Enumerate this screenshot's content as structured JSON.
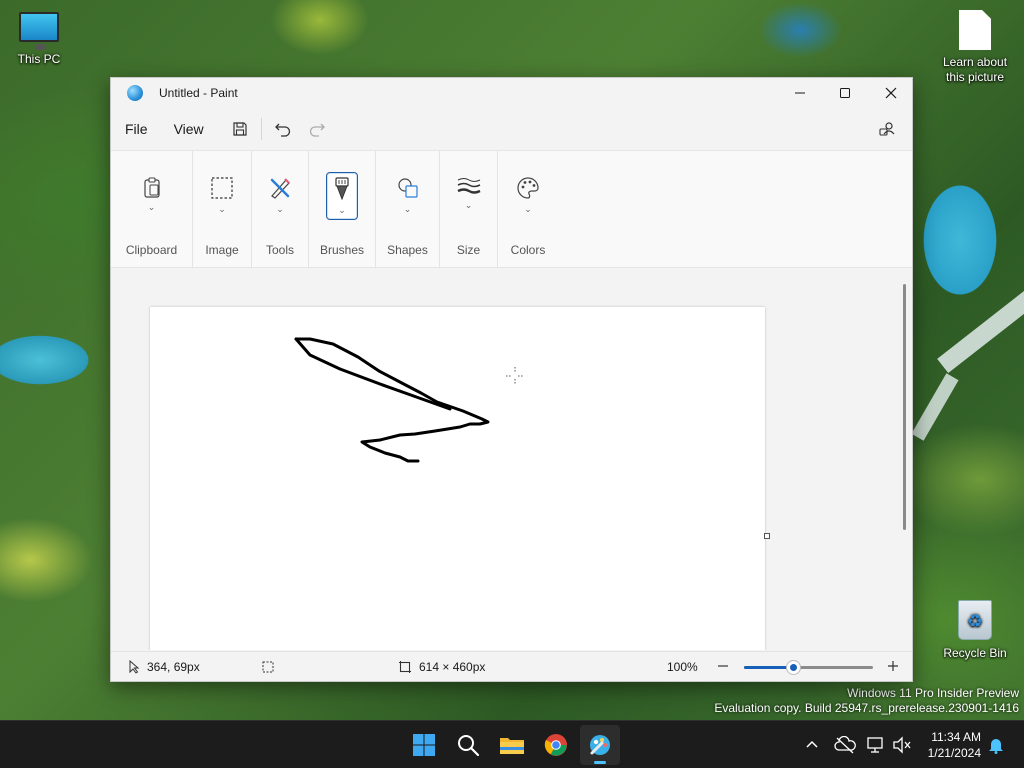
{
  "desktop": {
    "icons": [
      {
        "label": "This PC"
      },
      {
        "label": "Learn about\nthis picture",
        "line1": "Learn about",
        "line2": "this picture"
      },
      {
        "label": "Recycle Bin"
      }
    ],
    "watermark": {
      "line1": "Windows 11 Pro Insider Preview",
      "line2": "Evaluation copy. Build 25947.rs_prerelease.230901-1416"
    }
  },
  "window": {
    "title": "Untitled - Paint",
    "controls": {
      "minimize": "minimize",
      "maximize": "maximize",
      "close": "close"
    }
  },
  "menubar": {
    "file_label": "File",
    "view_label": "View"
  },
  "ribbon": {
    "groups": [
      {
        "label": "Clipboard",
        "icon": "clipboard-icon"
      },
      {
        "label": "Image",
        "icon": "select-icon"
      },
      {
        "label": "Tools",
        "icon": "tools-icon"
      },
      {
        "label": "Brushes",
        "icon": "brush-icon",
        "active": true
      },
      {
        "label": "Shapes",
        "icon": "shapes-icon"
      },
      {
        "label": "Size",
        "icon": "size-icon"
      },
      {
        "label": "Colors",
        "icon": "palette-icon"
      }
    ]
  },
  "statusbar": {
    "cursor_position": "364, 69px",
    "canvas_size": "614 × 460px",
    "zoom": "100%",
    "zoom_slider_fraction": 0.38
  },
  "taskbar": {
    "clock_time": "11:34 AM",
    "clock_date": "1/21/2024",
    "apps": [
      "start-icon",
      "search-icon",
      "file-explorer-icon",
      "chrome-icon",
      "paint-icon"
    ]
  },
  "colors": {
    "accent": "#1660b8",
    "taskbar_bg": "#1c1c1c"
  }
}
